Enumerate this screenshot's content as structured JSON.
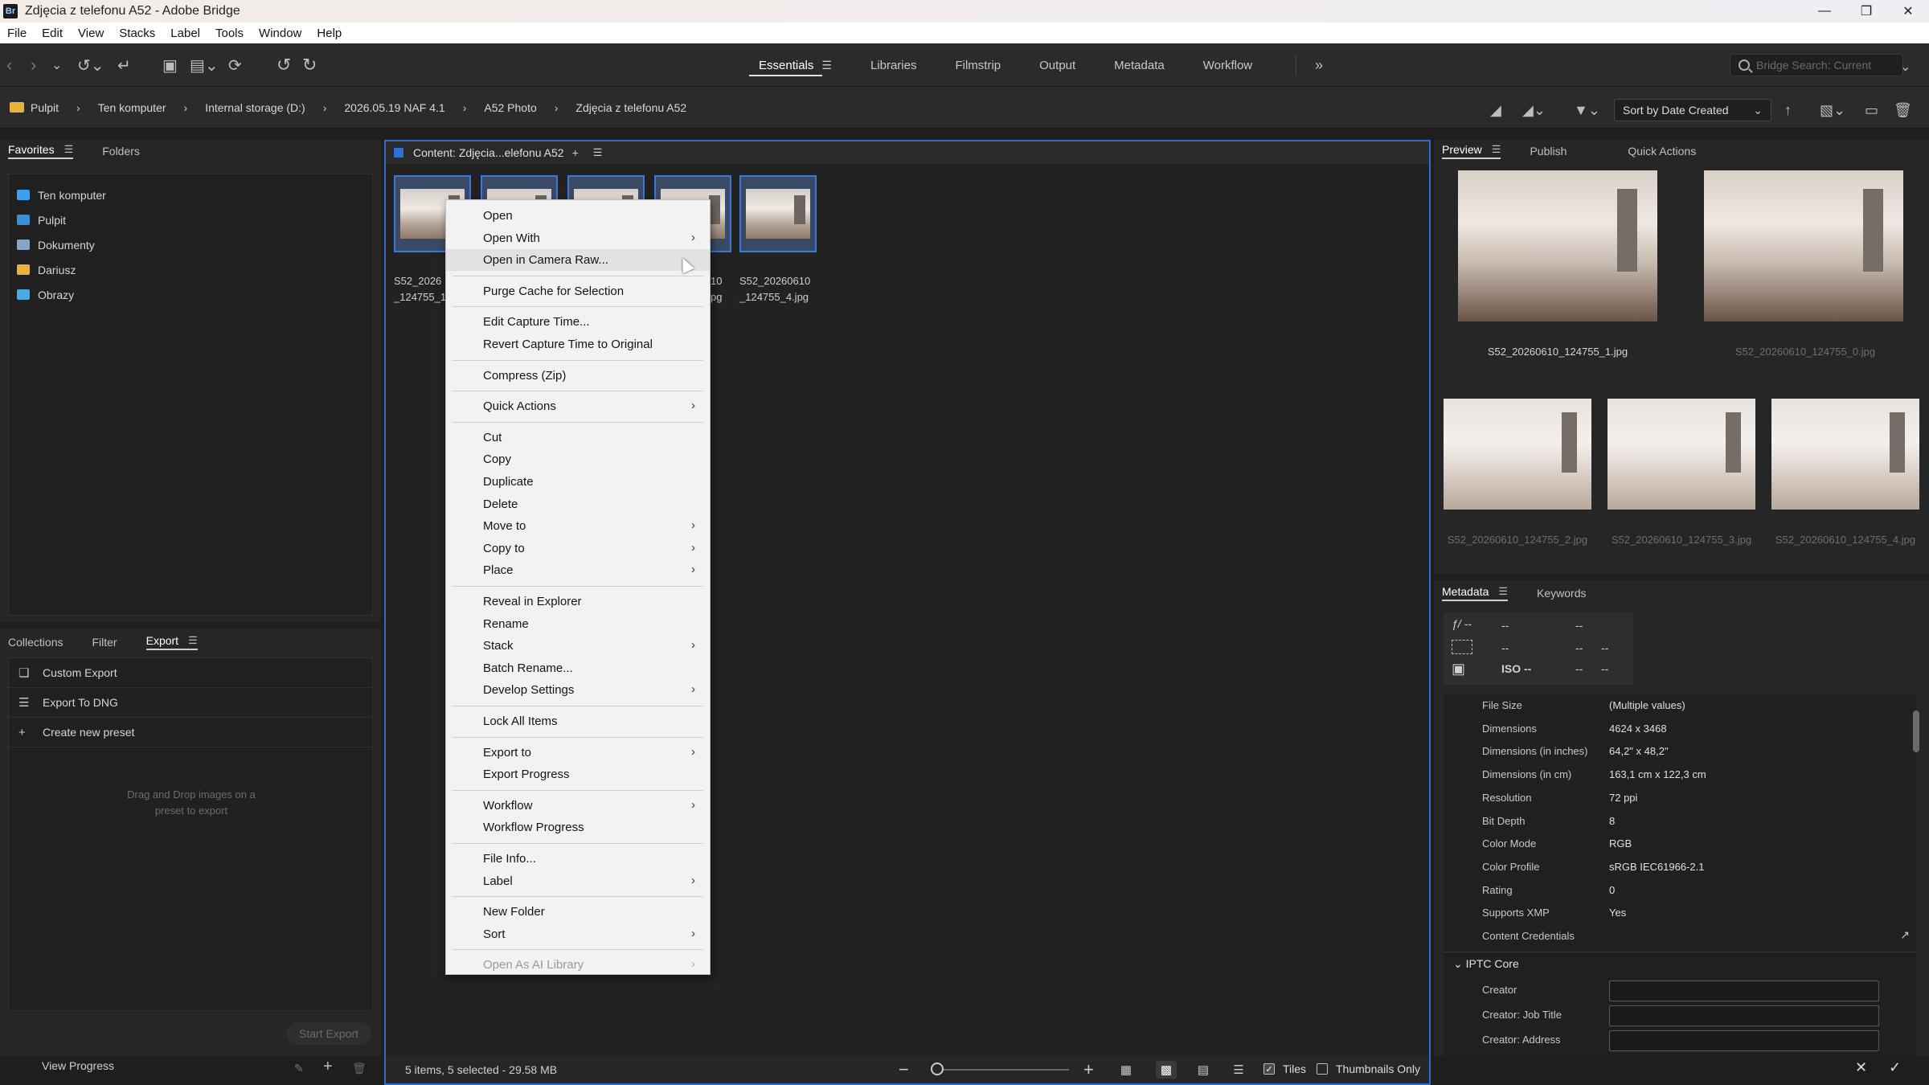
{
  "window": {
    "title": "Zdjęcia z telefonu A52 - Adobe Bridge",
    "app_badge": "Br"
  },
  "menubar": [
    "File",
    "Edit",
    "View",
    "Stacks",
    "Label",
    "Tools",
    "Window",
    "Help"
  ],
  "workspaces": {
    "items": [
      "Essentials",
      "Libraries",
      "Filmstrip",
      "Output",
      "Metadata",
      "Workflow"
    ],
    "active": "Essentials"
  },
  "search": {
    "placeholder": "Bridge Search: Current"
  },
  "breadcrumb": [
    "Pulpit",
    "Ten komputer",
    "Internal storage (D:)",
    "2026.05.19 NAF 4.1",
    "A52 Photo",
    "Zdjęcia z telefonu A52"
  ],
  "sort": {
    "selected": "Sort by Date Created"
  },
  "left_panel": {
    "tabs": [
      "Favorites",
      "Folders"
    ],
    "active_tab": "Favorites",
    "favorites": [
      {
        "label": "Ten komputer",
        "color": "#3ea0e8"
      },
      {
        "label": "Pulpit",
        "color": "#3a8fd8"
      },
      {
        "label": "Dokumenty",
        "color": "#8aa4c8"
      },
      {
        "label": "Dariusz",
        "color": "#e8b33c"
      },
      {
        "label": "Obrazy",
        "color": "#4ea8e0"
      }
    ]
  },
  "export_panel": {
    "tabs": [
      "Collections",
      "Filter",
      "Export"
    ],
    "active_tab": "Export",
    "items": [
      "Custom Export",
      "Export To DNG",
      "Create new preset"
    ],
    "drop_hint_line1": "Drag and Drop images on a",
    "drop_hint_line2": "preset to export",
    "start_export": "Start Export",
    "view_progress": "View Progress"
  },
  "content": {
    "tab_label": "Content: Zdjęcia...elefonu A52",
    "thumb_labels": [
      {
        "line1": "S52_2026",
        "line2": "_124755_1"
      },
      {
        "line1": "",
        "line2": ""
      },
      {
        "line1": "",
        "line2": ""
      },
      {
        "line1": "10",
        "line2": "pg"
      },
      {
        "line1": "S52_20260610",
        "line2": "_124755_4.jpg"
      }
    ],
    "status": "5 items, 5 selected - 29.58 MB",
    "tiles_label": "Tiles",
    "thumbs_only_label": "Thumbnails Only"
  },
  "context_menu": {
    "items": [
      {
        "label": "Open",
        "submenu": false
      },
      {
        "label": "Open With",
        "submenu": true
      },
      {
        "label": "Open in Camera Raw...",
        "submenu": false,
        "hover": true
      },
      {
        "sep": true
      },
      {
        "label": "Purge Cache for Selection",
        "submenu": false
      },
      {
        "sep": true
      },
      {
        "label": "Edit Capture Time...",
        "submenu": false
      },
      {
        "label": "Revert Capture Time to Original",
        "submenu": false
      },
      {
        "sep": true
      },
      {
        "label": "Compress (Zip)",
        "submenu": false
      },
      {
        "sep": true
      },
      {
        "label": "Quick Actions",
        "submenu": true
      },
      {
        "sep": true
      },
      {
        "label": "Cut",
        "submenu": false
      },
      {
        "label": "Copy",
        "submenu": false
      },
      {
        "label": "Duplicate",
        "submenu": false
      },
      {
        "label": "Delete",
        "submenu": false
      },
      {
        "label": "Move to",
        "submenu": true
      },
      {
        "label": "Copy to",
        "submenu": true
      },
      {
        "label": "Place",
        "submenu": true
      },
      {
        "sep": true
      },
      {
        "label": "Reveal in Explorer",
        "submenu": false
      },
      {
        "label": "Rename",
        "submenu": false
      },
      {
        "label": "Stack",
        "submenu": true
      },
      {
        "label": "Batch Rename...",
        "submenu": false
      },
      {
        "label": "Develop Settings",
        "submenu": true
      },
      {
        "sep": true
      },
      {
        "label": "Lock All Items",
        "submenu": false
      },
      {
        "sep": true
      },
      {
        "label": "Export to",
        "submenu": true
      },
      {
        "label": "Export Progress",
        "submenu": false
      },
      {
        "sep": true
      },
      {
        "label": "Workflow",
        "submenu": true
      },
      {
        "label": "Workflow Progress",
        "submenu": false
      },
      {
        "sep": true
      },
      {
        "label": "File Info...",
        "submenu": false
      },
      {
        "label": "Label",
        "submenu": true
      },
      {
        "sep": true
      },
      {
        "label": "New Folder",
        "submenu": false
      },
      {
        "label": "Sort",
        "submenu": true
      },
      {
        "sep": true
      },
      {
        "label": "Open As AI Library",
        "submenu": true,
        "disabled": true
      }
    ]
  },
  "preview": {
    "tabs": [
      "Preview",
      "Publish",
      "Quick Actions"
    ],
    "active_tab": "Preview",
    "large": [
      {
        "label": "S52_20260610_124755_1.jpg",
        "dim": false
      },
      {
        "label": "S52_20260610_124755_0.jpg",
        "dim": true
      }
    ],
    "small": [
      {
        "label": "S52_20260610_124755_2.jpg"
      },
      {
        "label": "S52_20260610_124755_3.jpg"
      },
      {
        "label": "S52_20260610_124755_4.jpg"
      }
    ]
  },
  "metadata": {
    "tabs": [
      "Metadata",
      "Keywords"
    ],
    "active_tab": "Metadata",
    "summary": {
      "aperture": "ƒ/ --",
      "dash": "--",
      "iso": "ISO --"
    },
    "rows": [
      {
        "key": "File Size",
        "value": "(Multiple values)"
      },
      {
        "key": "Dimensions",
        "value": "4624 x 3468"
      },
      {
        "key": "Dimensions (in inches)",
        "value": "64,2\" x 48,2\""
      },
      {
        "key": "Dimensions (in cm)",
        "value": "163,1 cm x 122,3 cm"
      },
      {
        "key": "Resolution",
        "value": "72 ppi"
      },
      {
        "key": "Bit Depth",
        "value": "8"
      },
      {
        "key": "Color Mode",
        "value": "RGB"
      },
      {
        "key": "Color Profile",
        "value": "sRGB IEC61966-2.1"
      },
      {
        "key": "Rating",
        "value": "0"
      },
      {
        "key": "Supports XMP",
        "value": "Yes"
      },
      {
        "key": "Content Credentials",
        "value": ""
      }
    ],
    "iptc_title": "IPTC Core",
    "iptc_rows": [
      "Creator",
      "Creator: Job Title",
      "Creator: Address"
    ]
  }
}
